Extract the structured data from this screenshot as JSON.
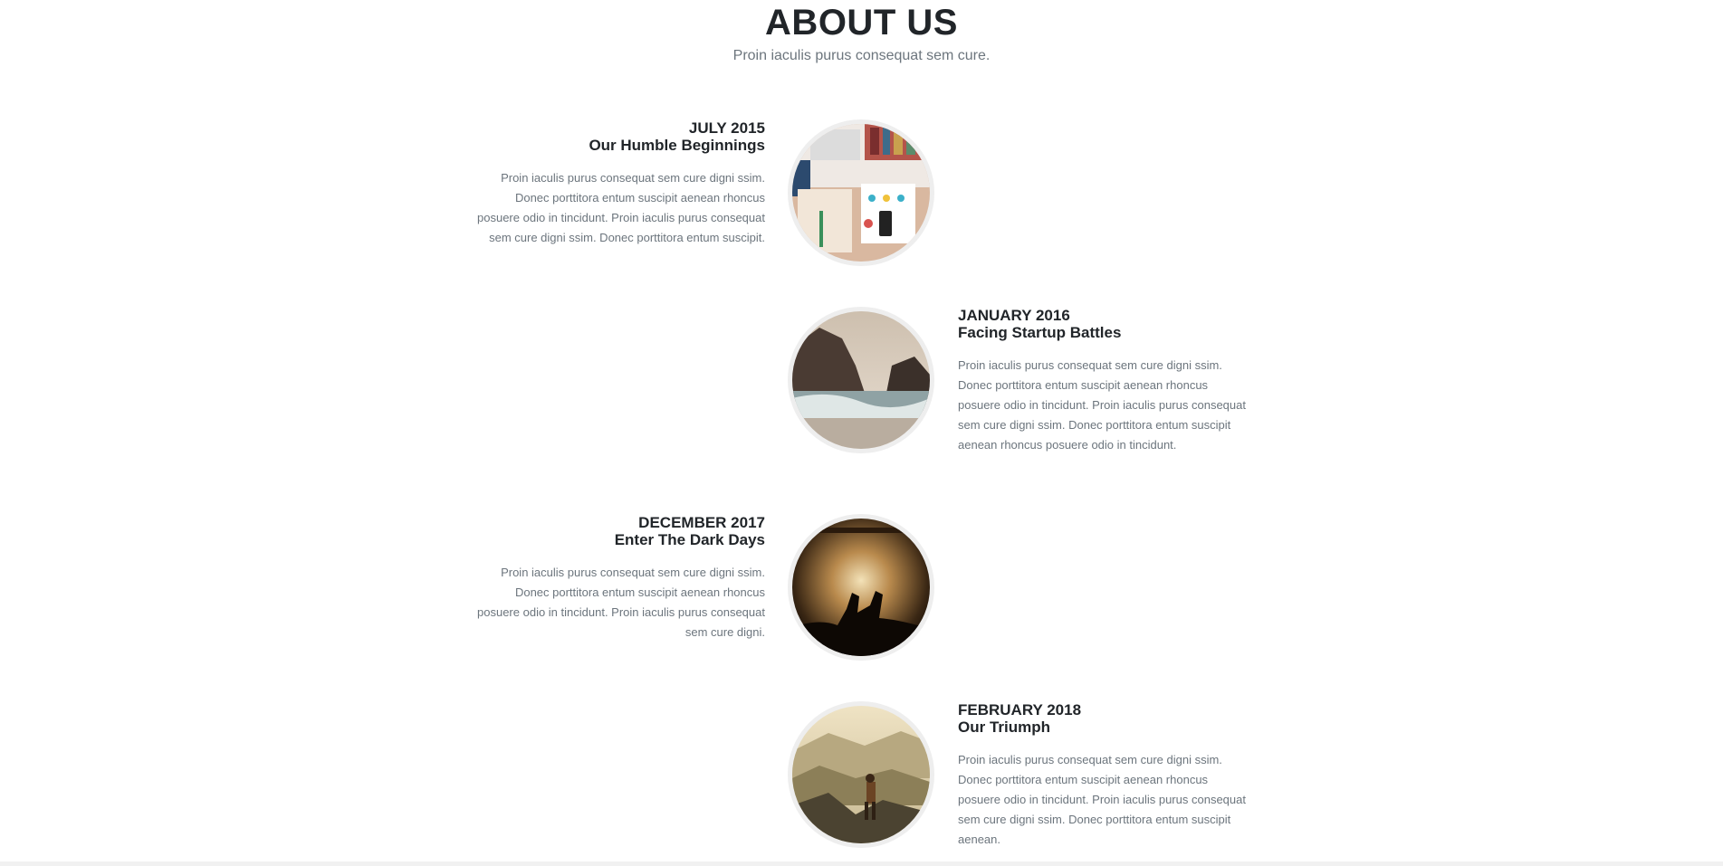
{
  "header": {
    "title": "ABOUT US",
    "subtitle": "Proin iaculis purus consequat sem cure."
  },
  "timeline": [
    {
      "date": "JULY 2015",
      "heading": "Our Humble Beginnings",
      "body": "Proin iaculis purus consequat sem cure digni ssim. Donec porttitora entum suscipit aenean rhoncus posuere odio in tincidunt. Proin iaculis purus consequat sem cure digni ssim. Donec porttitora entum suscipit.",
      "side": "left",
      "image": "desk-flatlay-photo"
    },
    {
      "date": "JANUARY 2016",
      "heading": "Facing Startup Battles",
      "body": "Proin iaculis purus consequat sem cure digni ssim. Donec porttitora entum suscipit aenean rhoncus posuere odio in tincidunt. Proin iaculis purus consequat sem cure digni ssim. Donec porttitora entum suscipit aenean rhoncus posuere odio in tincidunt.",
      "side": "right",
      "image": "rocky-beach-photo"
    },
    {
      "date": "DECEMBER 2017",
      "heading": "Enter The Dark Days",
      "body": "Proin iaculis purus consequat sem cure digni ssim. Donec porttitora entum suscipit aenean rhoncus posuere odio in tincidunt. Proin iaculis purus consequat sem cure digni.",
      "side": "left",
      "image": "concert-crowd-photo"
    },
    {
      "date": "FEBRUARY 2018",
      "heading": "Our Triumph",
      "body": "Proin iaculis purus consequat sem cure digni ssim. Donec porttitora entum suscipit aenean rhoncus posuere odio in tincidunt. Proin iaculis purus consequat sem cure digni ssim. Donec porttitora entum suscipit aenean.",
      "side": "right",
      "image": "mountain-hiker-photo"
    }
  ],
  "colors": {
    "heading": "#212529",
    "body_text": "#6c757d",
    "image_border": "#eeeeee",
    "footer_strip": "#f1f1f1"
  }
}
